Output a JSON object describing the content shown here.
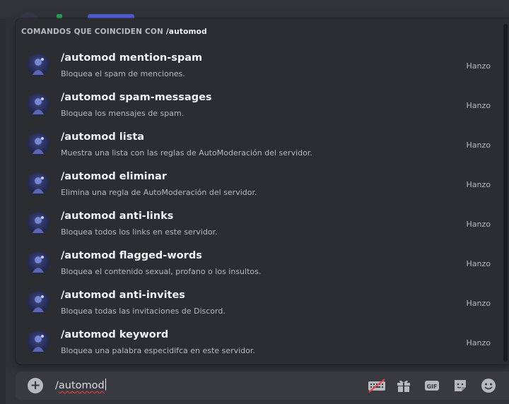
{
  "header": {
    "prefix": "COMANDOS QUE COINCIDEN CON",
    "query": "/automod"
  },
  "commands": [
    {
      "name": "/automod mention-spam",
      "description": "Bloquea el spam de menciones.",
      "app": "Hanzo"
    },
    {
      "name": "/automod spam-messages",
      "description": "Bloquea los mensajes de spam.",
      "app": "Hanzo"
    },
    {
      "name": "/automod lista",
      "description": "Muestra una lista con las reglas de AutoModeración del servidor.",
      "app": "Hanzo"
    },
    {
      "name": "/automod eliminar",
      "description": "Elimina una regla de AutoModeración del servidor.",
      "app": "Hanzo"
    },
    {
      "name": "/automod anti-links",
      "description": "Bloquea todos los links en este servidor.",
      "app": "Hanzo"
    },
    {
      "name": "/automod flagged-words",
      "description": "Bloquea el contenido sexual, profano o los insultos.",
      "app": "Hanzo"
    },
    {
      "name": "/automod anti-invites",
      "description": "Bloquea todas las invitaciones de Discord.",
      "app": "Hanzo"
    },
    {
      "name": "/automod keyword",
      "description": "Bloquea una palabra especidifca en este servidor.",
      "app": "Hanzo"
    }
  ],
  "input": {
    "slash": "/",
    "word": "automod"
  },
  "icons": {
    "plus": "plus-circle-icon",
    "keyboard": "keyboard-disabled-icon",
    "gift": "gift-icon",
    "gif": "GIF",
    "sticker": "sticker-icon",
    "emoji": "emoji-icon"
  },
  "colors": {
    "background": "#313338",
    "popup": "#2b2d31",
    "input": "#383a40",
    "accent": "#5865f2",
    "error": "#f23f43"
  }
}
